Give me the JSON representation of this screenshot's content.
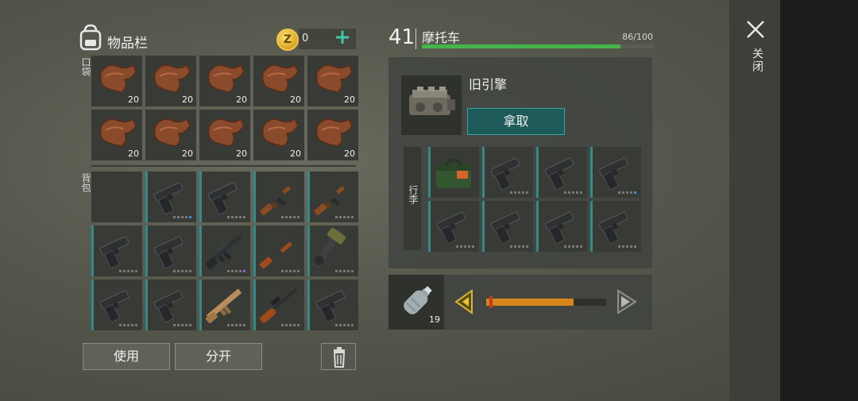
{
  "inventory": {
    "title": "物品栏",
    "coin_symbol": "Z",
    "coin_count": "0",
    "add_label": "+",
    "pocket_label": "口袋",
    "backpack_label": "背包",
    "pocket_slots": [
      {
        "item": "leather",
        "qty": "20"
      },
      {
        "item": "leather",
        "qty": "20"
      },
      {
        "item": "leather",
        "qty": "20"
      },
      {
        "item": "leather",
        "qty": "20"
      },
      {
        "item": "leather",
        "qty": "20"
      },
      {
        "item": "leather",
        "qty": "20"
      },
      {
        "item": "leather",
        "qty": "20"
      },
      {
        "item": "leather",
        "qty": "20"
      },
      {
        "item": "leather",
        "qty": "20"
      },
      {
        "item": "leather",
        "qty": "20"
      }
    ],
    "backpack_slots": [
      {
        "item": "empty"
      },
      {
        "item": "pistol",
        "dot": "blue"
      },
      {
        "item": "pistol"
      },
      {
        "item": "ak"
      },
      {
        "item": "ak"
      },
      {
        "item": "pistol"
      },
      {
        "item": "pistol"
      },
      {
        "item": "m16",
        "dot": "purple"
      },
      {
        "item": "shotgun"
      },
      {
        "item": "flamethrower"
      },
      {
        "item": "pistol"
      },
      {
        "item": "pistol"
      },
      {
        "item": "scar"
      },
      {
        "item": "sniper"
      },
      {
        "item": "pistol"
      }
    ],
    "use_label": "使用",
    "split_label": "分开"
  },
  "vehicle": {
    "level": "41",
    "name": "摩托车",
    "capacity_text": "86/100",
    "capacity_fraction": 0.86,
    "engine_name": "旧引擎",
    "take_label": "拿取",
    "luggage_label": "行李",
    "luggage_slots": [
      {
        "item": "medkit"
      },
      {
        "item": "pistol"
      },
      {
        "item": "pistol"
      },
      {
        "item": "pistol",
        "dot": "blue"
      },
      {
        "item": "pistol"
      },
      {
        "item": "pistol"
      },
      {
        "item": "pistol"
      },
      {
        "item": "pistol"
      }
    ]
  },
  "splitter": {
    "item": "water-bottle",
    "qty": "19",
    "fraction": 0.73
  },
  "close_label": "关闭",
  "colors": {
    "accent_teal": "#2f8c8a",
    "progress_green": "#44b54a",
    "slider_orange": "#d8861c",
    "coin_gold": "#f3c64a"
  }
}
